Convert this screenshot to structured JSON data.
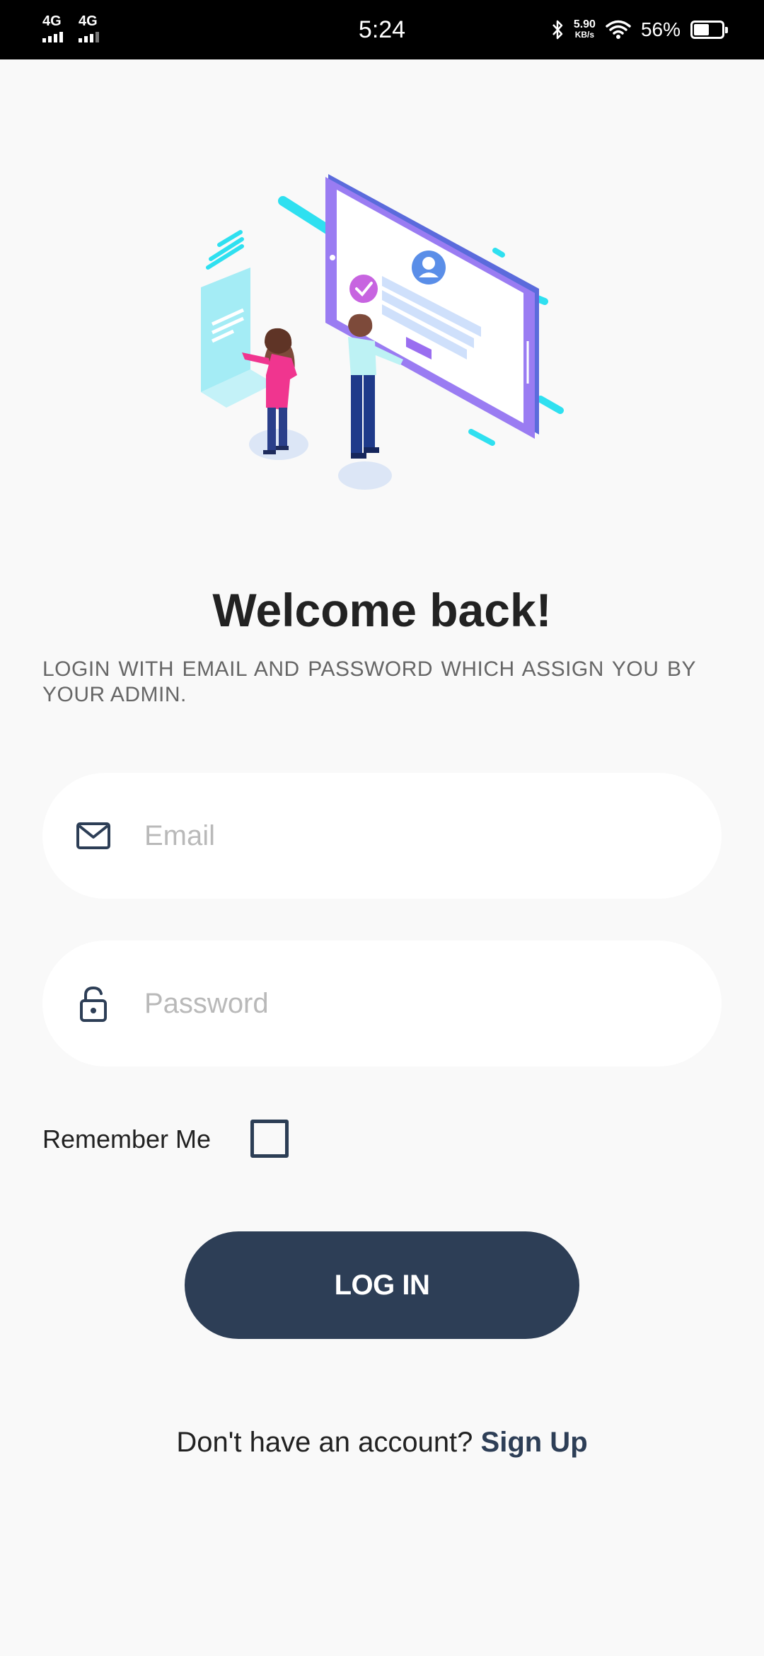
{
  "status_bar": {
    "network_1": "4G",
    "network_2": "4G",
    "time": "5:24",
    "speed_value": "5.90",
    "speed_unit": "KB/s",
    "battery_percent": "56%",
    "battery_level": 0.56
  },
  "illustration": {
    "description_icon": "login-illustration"
  },
  "header": {
    "title": "Welcome back!",
    "subtitle": "LOGIN WITH EMAIL AND PASSWORD WHICH ASSIGN YOU BY YOUR ADMIN."
  },
  "form": {
    "email": {
      "placeholder": "Email",
      "value": "",
      "icon": "mail-icon"
    },
    "password": {
      "placeholder": "Password",
      "value": "",
      "icon": "lock-icon"
    },
    "remember_label": "Remember Me",
    "remember_checked": false,
    "login_label": "LOG IN"
  },
  "footer": {
    "prompt": "Don't have an account?",
    "link_label": "Sign Up"
  },
  "colors": {
    "background": "#f9f9f9",
    "primary": "#2d3e56",
    "status_bar": "#000000"
  }
}
